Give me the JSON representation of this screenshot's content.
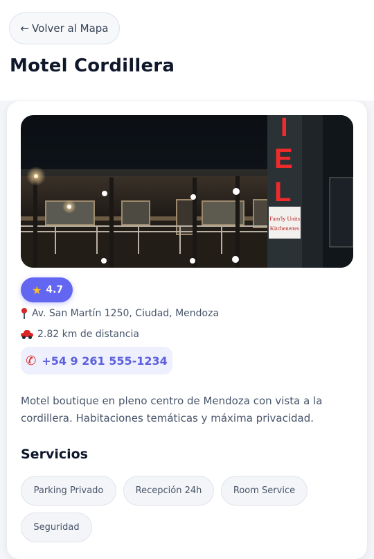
{
  "header": {
    "back_label": "Volver al Mapa",
    "back_arrow": "←",
    "title": "Motel Cordillera"
  },
  "photo": {
    "sign_letters": "IEL",
    "sign_panel_line1": "Fam'ly Units",
    "sign_panel_line2": "Kitchenettes"
  },
  "details": {
    "rating": "4.7",
    "rating_icon": "star-icon",
    "address": "Av. San Martín 1250, Ciudad, Mendoza",
    "address_icon": "pin-icon",
    "distance": "2.82 km de distancia",
    "distance_icon": "car-icon",
    "phone": "+54 9 261 555-1234",
    "phone_icon": "phone-icon",
    "description": "Motel boutique en pleno centro de Mendoza con vista a la cordillera. Habitaciones temáticas y máxima privacidad."
  },
  "services": {
    "title": "Servicios",
    "items": [
      "Parking Privado",
      "Recepción 24h",
      "Room Service",
      "Seguridad"
    ]
  },
  "colors": {
    "accent": "#6366f1",
    "phone_bg": "#eef0fd",
    "sign_red": "#ef2a2a",
    "title": "#0f172a"
  }
}
